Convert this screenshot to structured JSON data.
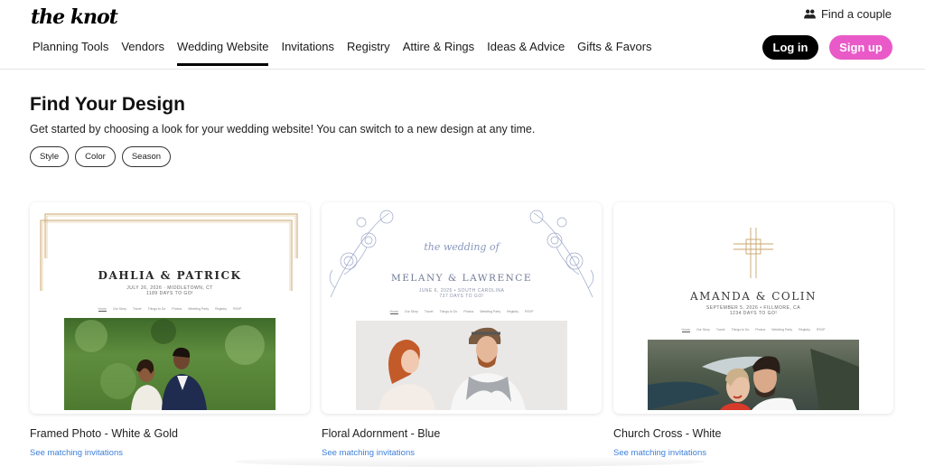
{
  "header": {
    "logo": "the knot",
    "find_couple": "Find a couple",
    "nav": [
      {
        "label": "Planning Tools",
        "active": false
      },
      {
        "label": "Vendors",
        "active": false
      },
      {
        "label": "Wedding Website",
        "active": true
      },
      {
        "label": "Invitations",
        "active": false
      },
      {
        "label": "Registry",
        "active": false
      },
      {
        "label": "Attire & Rings",
        "active": false
      },
      {
        "label": "Ideas & Advice",
        "active": false
      },
      {
        "label": "Gifts & Favors",
        "active": false
      }
    ],
    "login_label": "Log in",
    "signup_label": "Sign up"
  },
  "main": {
    "title": "Find Your Design",
    "subtitle": "Get started by choosing a look for your wedding website! You can switch to a new design at any time.",
    "filters": [
      "Style",
      "Color",
      "Season"
    ]
  },
  "mini_nav": [
    "Home",
    "Our Story",
    "Travel",
    "Things to Do",
    "Photos",
    "Wedding Party",
    "Registry",
    "RSVP"
  ],
  "cards": [
    {
      "name": "Framed Photo - White & Gold",
      "link": "See matching invitations",
      "preview": {
        "couple": "DAHLIA & PATRICK",
        "date_line": "JULY 26, 2026 · MIDDLETOWN, CT",
        "countdown": "1189 DAYS TO GO!"
      }
    },
    {
      "name": "Floral Adornment - Blue",
      "link": "See matching invitations",
      "preview": {
        "script": "the wedding of",
        "couple": "MELANY & LAWRENCE",
        "date_line": "JUNE 6, 2025 • SOUTH CAROLINA",
        "countdown": "737 DAYS TO GO!"
      }
    },
    {
      "name": "Church Cross - White",
      "link": "See matching invitations",
      "preview": {
        "couple": "AMANDA & COLIN",
        "date_line": "SEPTEMBER 5, 2026 • FILLMORE, CA",
        "countdown": "1234 DAYS TO GO!"
      }
    }
  ],
  "colors": {
    "signup_pink": "#e95ac8",
    "link_blue": "#3d7fd9",
    "gold": "#c9a66b",
    "floral_blue": "#7c8db8"
  }
}
